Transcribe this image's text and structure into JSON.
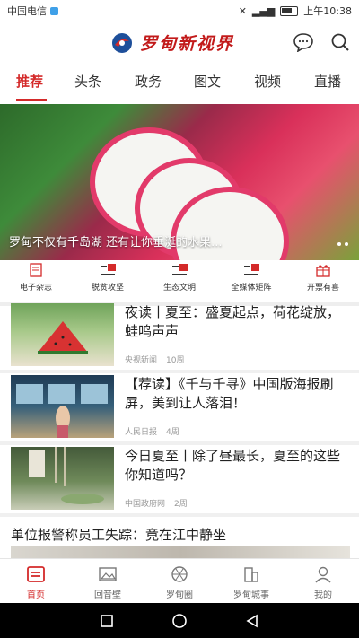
{
  "status_bar": {
    "carrier": "中国电信",
    "time": "上午10:38"
  },
  "app": {
    "title": "罗甸新视界"
  },
  "tabs": [
    {
      "label": "推荐",
      "active": true
    },
    {
      "label": "头条"
    },
    {
      "label": "政务"
    },
    {
      "label": "图文"
    },
    {
      "label": "视频"
    },
    {
      "label": "直播"
    }
  ],
  "banner": {
    "caption": "罗甸不仅有千岛湖 还有让你垂涎的水果..."
  },
  "quick_nav": [
    {
      "label": "电子杂志",
      "icon": "magazine-icon"
    },
    {
      "label": "脱贫攻坚",
      "icon": "flag-icon"
    },
    {
      "label": "生态文明",
      "icon": "flag-icon"
    },
    {
      "label": "全媒体矩阵",
      "icon": "flag-icon"
    },
    {
      "label": "开票有喜",
      "icon": "gift-icon"
    }
  ],
  "news": [
    {
      "title": "夜读丨夏至：盛夏起点，荷花绽放，蛙鸣声声",
      "source": "央视新闻",
      "time": "10周"
    },
    {
      "title": "【荐读】《千与千寻》中国版海报刷屏，美到让人落泪！",
      "source": "人民日报",
      "time": "4周"
    },
    {
      "title": "今日夏至丨除了昼最长，夏至的这些你知道吗？",
      "source": "中国政府网",
      "time": "2周"
    }
  ],
  "long_item": {
    "title": "单位报警称员工失踪：竟在江中静坐"
  },
  "bottom_nav": [
    {
      "label": "首页",
      "icon": "home-icon",
      "active": true
    },
    {
      "label": "回音壁",
      "icon": "image-icon"
    },
    {
      "label": "罗甸圈",
      "icon": "aperture-icon"
    },
    {
      "label": "罗甸城事",
      "icon": "city-icon"
    },
    {
      "label": "我的",
      "icon": "user-icon"
    }
  ],
  "colors": {
    "accent": "#d42a2a",
    "brand": "#c21a1a"
  }
}
